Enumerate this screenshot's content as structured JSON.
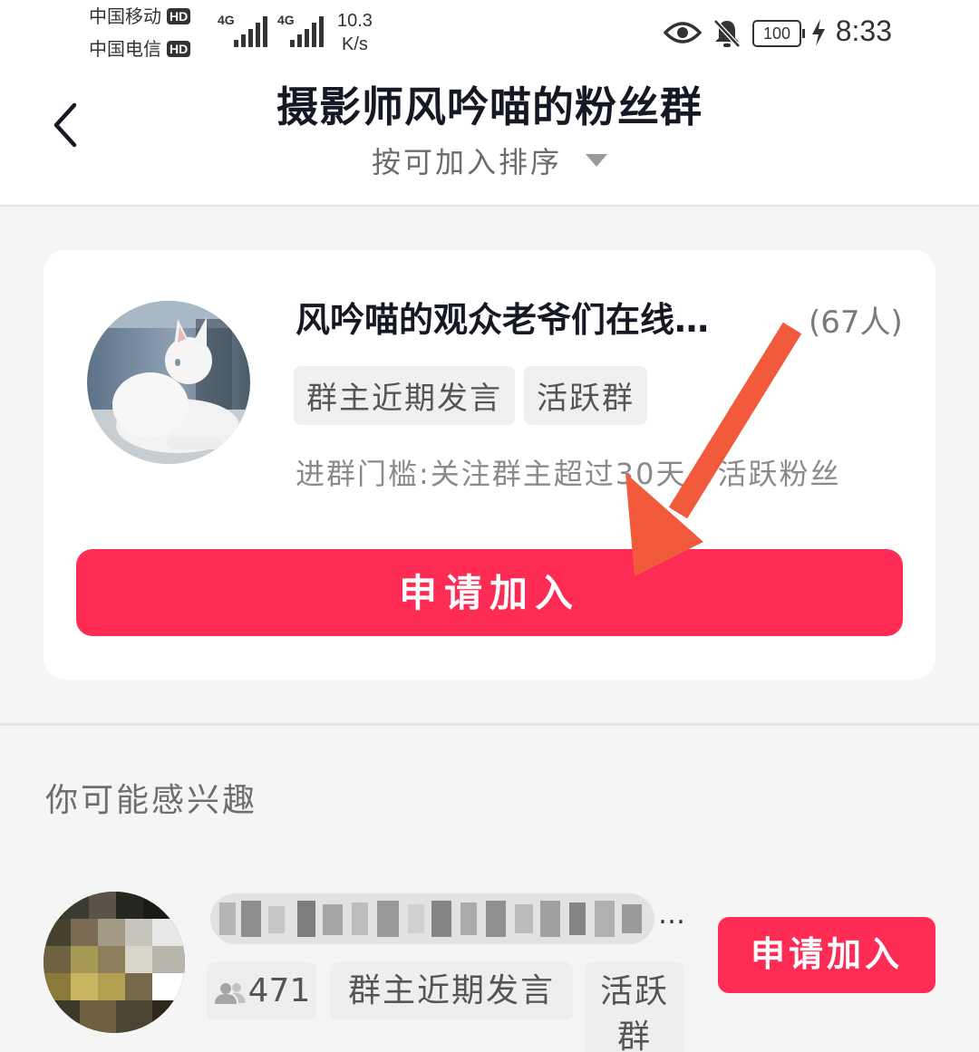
{
  "status_bar": {
    "carrier_1": "中国移动",
    "carrier_2": "中国电信",
    "hd_badge": "HD",
    "network_1": "4G",
    "network_2": "4G",
    "speed_value": "10.3",
    "speed_unit": "K/s",
    "battery": "100",
    "time": "8:33"
  },
  "header": {
    "title": "摄影师风吟喵的粉丝群",
    "sort_label": "按可加入排序"
  },
  "group_card": {
    "name": "风吟喵的观众老爷们在线…",
    "member_count": "(67人)",
    "tags": [
      "群主近期发言",
      "活跃群"
    ],
    "threshold": "进群门槛:关注群主超过30天、活跃粉丝",
    "join_button": "申请加入"
  },
  "recommend": {
    "section_title": "你可能感兴趣",
    "item": {
      "ellipsis": "…",
      "member_count": "471",
      "tags": [
        "群主近期发言",
        "活跃群"
      ],
      "join_button": "申请加入"
    }
  },
  "colors": {
    "accent": "#fe2c55",
    "annotation_arrow": "#f25a3c"
  },
  "icons": [
    "back-arrow-icon",
    "eye-icon",
    "bell-off-icon",
    "battery-icon",
    "charging-bolt-icon",
    "dropdown-triangle-icon",
    "members-icon"
  ]
}
